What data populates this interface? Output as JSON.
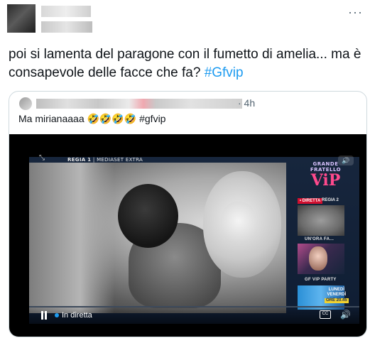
{
  "tweet": {
    "text_main": "poi si lamenta del paragone con il fumetto di amelia... ma è consapevole delle facce che fa? ",
    "hashtag": "#Gfvip"
  },
  "quote": {
    "time": "· 4h",
    "text": "Ma mirianaaaa 🤣🤣🤣🤣 #gfvip",
    "video": {
      "feed_label_regia": "REGIA 1",
      "feed_label_channel": "MEDIASET EXTRA",
      "logo_line1": "GRANDE",
      "logo_line2": "FRATELLO",
      "logo_vip": "ViP",
      "live_badge": "• DIRETTA",
      "regia2": "REGIA 2",
      "sub1": "UN'ORA FA...",
      "sub2": "GF VIP PARTY",
      "thumb3_line1": "LUNEDÌ",
      "thumb3_line2": "VENERDÌ",
      "thumb3_time": "ORE 20.45",
      "live_status": "In diretta"
    }
  },
  "icons": {
    "more": "more-icon",
    "pause": "pause-icon",
    "captions": "captions-icon",
    "volume": "volume-icon",
    "expand": "expand-icon"
  },
  "colors": {
    "hashtag": "#1d9bf0",
    "secondary_text": "#536471",
    "card_border": "#cfd9de",
    "live_red": "#d10f2f"
  }
}
